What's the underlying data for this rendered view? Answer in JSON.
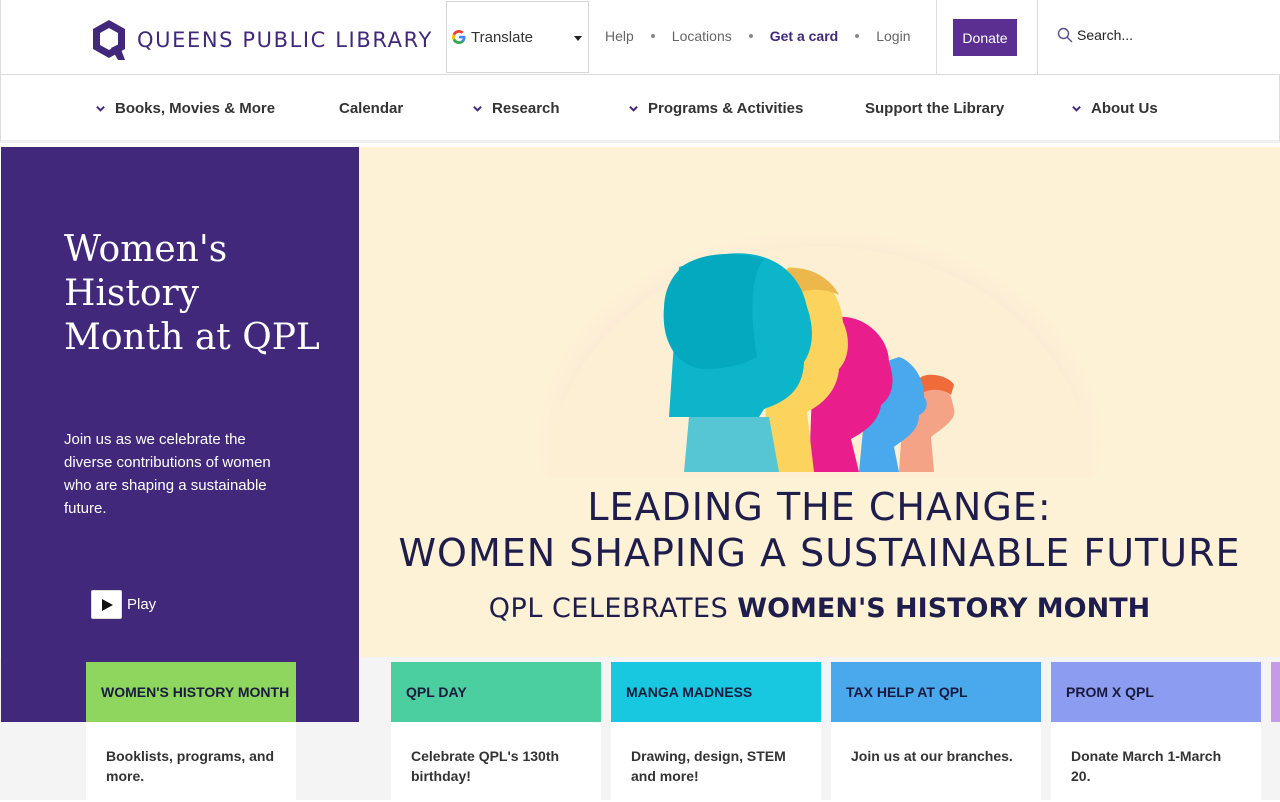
{
  "header": {
    "logo_text": "QUEENS PUBLIC LIBRARY",
    "translate_label": "Translate",
    "util_links": [
      {
        "label": "Help"
      },
      {
        "label": "Locations"
      },
      {
        "label": "Get a card"
      },
      {
        "label": "Login"
      }
    ],
    "donate_label": "Donate",
    "search_placeholder": "Search..."
  },
  "nav": {
    "items": [
      {
        "label": "Books, Movies & More",
        "has_menu": true
      },
      {
        "label": "Calendar",
        "has_menu": false
      },
      {
        "label": "Research",
        "has_menu": true
      },
      {
        "label": "Programs & Activities",
        "has_menu": true
      },
      {
        "label": "Support the Library",
        "has_menu": false
      },
      {
        "label": "About Us",
        "has_menu": true
      }
    ]
  },
  "hero": {
    "title": "Women's History Month at QPL",
    "description": "Join us as we celebrate the diverse contributions of women who are shaping a sustainable future.",
    "play_label": "Play",
    "banner": {
      "line1": "LEADING THE CHANGE:",
      "line2": "WOMEN SHAPING A SUSTAINABLE FUTURE",
      "line3_light": "QPL CELEBRATES ",
      "line3_bold": "WOMEN'S HISTORY MONTH"
    }
  },
  "cards": [
    {
      "title": "WOMEN'S HISTORY MONTH",
      "text": "Booklists, programs, and more.",
      "color": "#8fd65f"
    },
    {
      "title": "QPL DAY",
      "text": "Celebrate QPL's 130th birthday!",
      "color": "#4ccfa0"
    },
    {
      "title": "MANGA MADNESS",
      "text": "Drawing, design, STEM and more!",
      "color": "#17c8e0"
    },
    {
      "title": "TAX HELP AT QPL",
      "text": "Join us at our branches.",
      "color": "#4aa8ec"
    },
    {
      "title": "PROM X QPL",
      "text": "Donate March 1-March 20.",
      "color": "#8c9cf0"
    }
  ],
  "colors": {
    "brand_purple": "#41287a",
    "donate_purple": "#5b2e91",
    "banner_bg": "#fdf2d6",
    "banner_text": "#1e1d4c"
  }
}
